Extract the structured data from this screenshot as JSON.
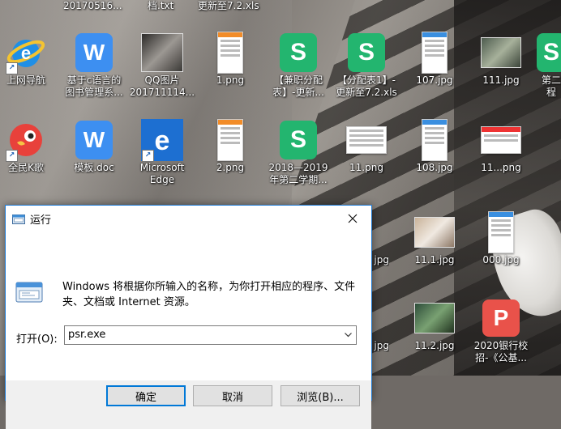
{
  "desktop": {
    "top_row_labels": [
      "20170516...",
      "档.txt",
      "更新至7.2.xls"
    ],
    "icons": [
      {
        "label": "上网导航",
        "kind": "ie",
        "shortcut": true
      },
      {
        "label": "基于c语言的\n图书管理系...",
        "kind": "wps-w",
        "shortcut": false
      },
      {
        "label": "QQ图片\n201711114...",
        "kind": "qq-photo",
        "shortcut": false
      },
      {
        "label": "1.png",
        "kind": "thumb-port",
        "shortcut": false
      },
      {
        "label": "【兼职分配\n表】-更新...",
        "kind": "wps-s",
        "shortcut": false
      },
      {
        "label": "【分配表1】-\n更新至7.2.xls",
        "kind": "wps-s",
        "shortcut": false
      },
      {
        "label": "107.jpg",
        "kind": "thumb-port",
        "shortcut": false
      },
      {
        "label": "111.jpg",
        "kind": "photo",
        "shortcut": false
      },
      {
        "label": "第二\n程",
        "kind": "wps-s",
        "shortcut": false
      },
      {
        "label": "全民K歌",
        "kind": "kge",
        "shortcut": true
      },
      {
        "label": "模板.doc",
        "kind": "wps-w",
        "shortcut": false
      },
      {
        "label": "Microsoft\nEdge",
        "kind": "edge",
        "shortcut": true
      },
      {
        "label": "2.png",
        "kind": "thumb-port",
        "shortcut": false
      },
      {
        "label": "2018—2019\n年第二学期...",
        "kind": "wps-s",
        "shortcut": false
      },
      {
        "label": "11.png",
        "kind": "thumb-land",
        "shortcut": false
      },
      {
        "label": "108.jpg",
        "kind": "thumb-port",
        "shortcut": false
      },
      {
        "label": "11...png",
        "kind": "thumb-land",
        "shortcut": false
      },
      {
        "label": "jpg",
        "kind": "none",
        "shortcut": false
      },
      {
        "label": "11.1.jpg",
        "kind": "photo-b",
        "shortcut": false
      },
      {
        "label": "000.jpg",
        "kind": "thumb-port",
        "shortcut": false
      },
      {
        "label": "jpg",
        "kind": "none",
        "shortcut": false
      },
      {
        "label": "11.2.jpg",
        "kind": "photo-c",
        "shortcut": false
      },
      {
        "label": "2020银行校\n招-《公基...",
        "kind": "wps-p",
        "shortcut": false
      }
    ]
  },
  "run_dialog": {
    "title": "运行",
    "close_icon": "close-icon",
    "description": "Windows 将根据你所输入的名称，为你打开相应的程序、文件夹、文档或 Internet 资源。",
    "open_label": "打开(O):",
    "command_value": "psr.exe",
    "buttons": {
      "ok": "确定",
      "cancel": "取消",
      "browse": "浏览(B)..."
    },
    "accent_color": "#0078d7"
  }
}
